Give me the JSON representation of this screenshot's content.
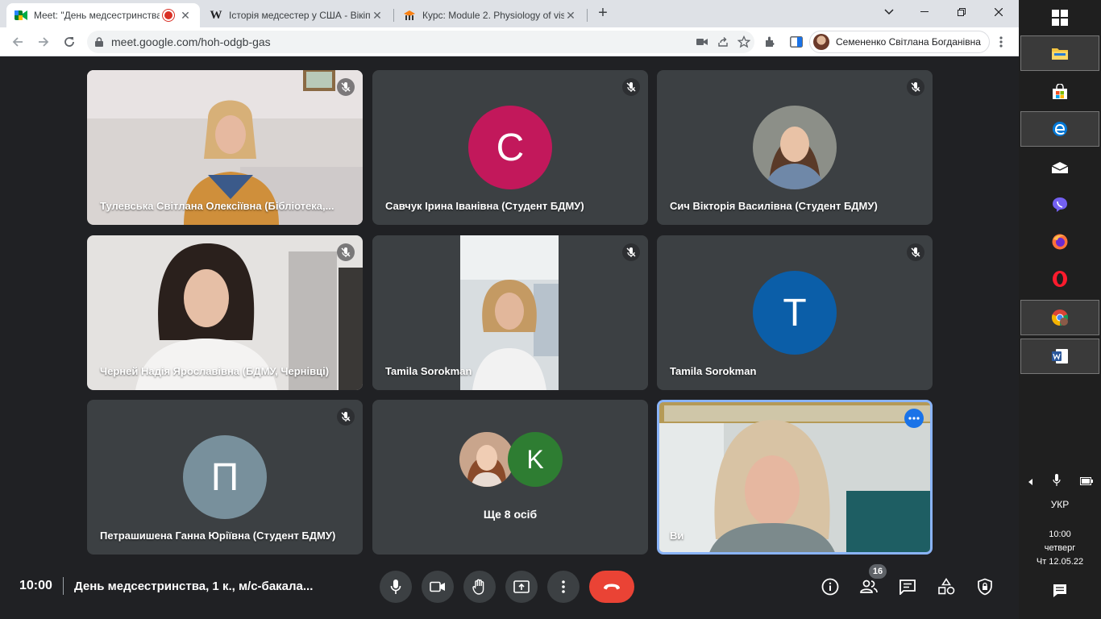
{
  "browser": {
    "tabs": [
      {
        "title": "Meet: \"День медсестринства",
        "favicon": "google-meet",
        "recording": true
      },
      {
        "title": "Історія медсестер у США - Вікіп",
        "favicon": "W"
      },
      {
        "title": "Курс: Module 2. Physiology of vis",
        "favicon": "moodle"
      }
    ],
    "new_tab": "+",
    "url": "meet.google.com/hoh-odgb-gas",
    "profile_name": "Семененко Світлана Богданівна"
  },
  "meet": {
    "tiles": [
      {
        "name": "Тулевська Світлана Олексіївна (Бібліотека,...",
        "type": "video",
        "muted": true
      },
      {
        "name": "Савчук Ірина Іванівна (Студент БДМУ)",
        "type": "letter",
        "letter": "С",
        "color": "#c2185b",
        "muted": true
      },
      {
        "name": "Сич Вікторія Василівна (Студент БДМУ)",
        "type": "photo",
        "muted": true
      },
      {
        "name": "Черней Надія Ярославівна (БДМУ, Чернівці)",
        "type": "video",
        "muted": true
      },
      {
        "name": "Tamila Sorokman",
        "type": "video",
        "muted": true
      },
      {
        "name": "Tamila Sorokman",
        "type": "letter",
        "letter": "T",
        "color": "#0b5ea8",
        "muted": true
      },
      {
        "name": "Петрашишена Ганна Юріївна (Студент БДМУ)",
        "type": "letter",
        "letter": "П",
        "color": "#78909c",
        "muted": true
      },
      {
        "name": "",
        "type": "more",
        "more_label": "Ще 8 осіб",
        "letter": "K",
        "color": "#2e7d32"
      },
      {
        "name": "Ви",
        "type": "self"
      }
    ],
    "time": "10:00",
    "title": "День медсестринства, 1 к., м/с-бакала...",
    "participants_count": "16"
  },
  "taskbar": {
    "language": "УКР",
    "clock_time": "10:00",
    "clock_day": "четверг",
    "clock_date": "Чт 12.05.22"
  }
}
